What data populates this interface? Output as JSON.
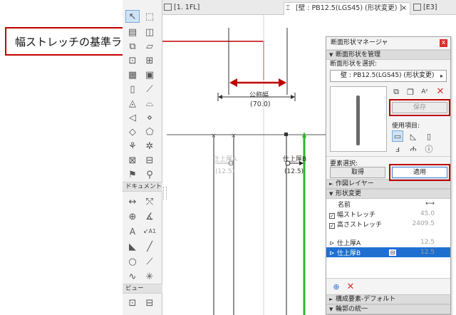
{
  "callout": {
    "text": "幅ストレッチの基準ライン",
    "return_mark": "↵"
  },
  "tabs": [
    {
      "label": "[1. 1FL]",
      "active": false
    },
    {
      "label": "[壁 : PB12.5(LGS45) (形状変更) ]",
      "active": true
    },
    {
      "label": "[E3]",
      "active": false
    }
  ],
  "tab_close": "×",
  "palette": {
    "document_header": "ドキュメント",
    "view_header": "ビュー",
    "text_tool": "A",
    "label_tool": "A1"
  },
  "drawing": {
    "nominal_width_label": "公称幅",
    "nominal_width_value": "(70.0)",
    "finish_a_label": "仕上厚A",
    "finish_a_value": "(12.5)",
    "finish_b_label": "仕上厚B",
    "finish_b_value": "(12.5)",
    "colors": {
      "highlight": "#c00000",
      "green_edge": "#2db52d",
      "line": "#6e6e6e"
    }
  },
  "panel": {
    "title": "断面形状マネージャ",
    "close_glyph": "x",
    "sections": {
      "manage": "断面形状を管理",
      "work_layer": "作図レイヤー",
      "shape_change": "形状変更",
      "component_default": "構成要素-デフォルト",
      "outline_unify": "輪郭の統一"
    },
    "select_label": "断面形状を選択:",
    "selected_profile": "壁 : PB12.5(LGS45) (形状変更)",
    "save_button": "保存",
    "use_items_label": "使用項目:",
    "element_select_label": "要素選択:",
    "get_button": "取得",
    "apply_button": "適用",
    "table": {
      "name_header": "名前",
      "rows": [
        {
          "name": "幅ストレッチ",
          "value": "45.0",
          "checked": true
        },
        {
          "name": "高さストレッチ",
          "value": "2409.5",
          "checked": true
        },
        {
          "name": "仕上厚A",
          "value": "12.5",
          "checked": false
        },
        {
          "name": "仕上厚B",
          "value": "12.5",
          "checked": false,
          "selected": true
        }
      ]
    }
  }
}
